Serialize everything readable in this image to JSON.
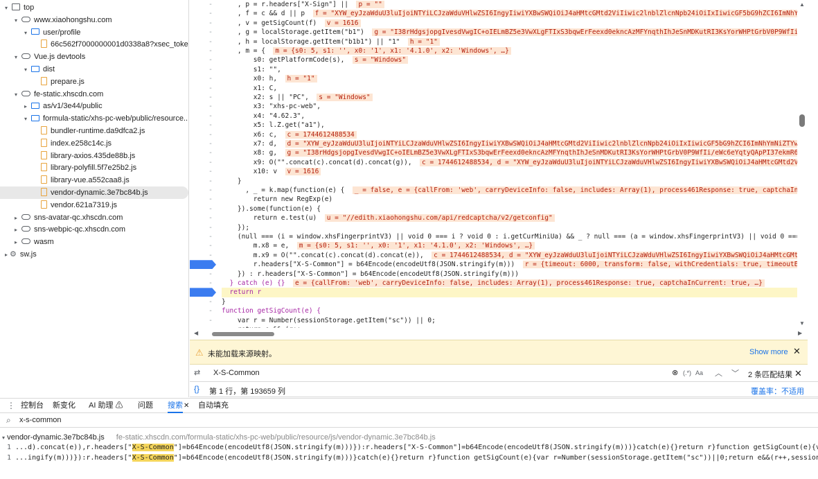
{
  "sources_tree": [
    {
      "label": "top",
      "icon": "frame-icon",
      "indent": 0,
      "arrow": "▾"
    },
    {
      "label": "www.xiaohongshu.com",
      "icon": "cloud-icon",
      "indent": 1,
      "arrow": "▾"
    },
    {
      "label": "user/profile",
      "icon": "folder-icon",
      "indent": 2,
      "arrow": "▾"
    },
    {
      "label": "66c562f7000000001d0338a8?xsec_token...",
      "icon": "file-icon",
      "indent": 3,
      "arrow": ""
    },
    {
      "label": "Vue.js devtools",
      "icon": "cloud-icon",
      "indent": 1,
      "arrow": "▾"
    },
    {
      "label": "dist",
      "icon": "folder-icon",
      "indent": 2,
      "arrow": "▾"
    },
    {
      "label": "prepare.js",
      "icon": "file-icon",
      "indent": 3,
      "arrow": ""
    },
    {
      "label": "fe-static.xhscdn.com",
      "icon": "cloud-icon",
      "indent": 1,
      "arrow": "▾"
    },
    {
      "label": "as/v1/3e44/public",
      "icon": "folder-icon",
      "indent": 2,
      "arrow": "▸"
    },
    {
      "label": "formula-static/xhs-pc-web/public/resource...",
      "icon": "folder-icon",
      "indent": 2,
      "arrow": "▾"
    },
    {
      "label": "bundler-runtime.da9dfca2.js",
      "icon": "file-icon",
      "indent": 3,
      "arrow": ""
    },
    {
      "label": "index.e258c14c.js",
      "icon": "file-icon",
      "indent": 3,
      "arrow": ""
    },
    {
      "label": "library-axios.435de88b.js",
      "icon": "file-icon",
      "indent": 3,
      "arrow": ""
    },
    {
      "label": "library-polyfill.5f7e25b2.js",
      "icon": "file-icon",
      "indent": 3,
      "arrow": ""
    },
    {
      "label": "library-vue.a552caa8.js",
      "icon": "file-icon",
      "indent": 3,
      "arrow": ""
    },
    {
      "label": "vendor-dynamic.3e7bc84b.js",
      "icon": "file-icon",
      "indent": 3,
      "arrow": "",
      "selected": true
    },
    {
      "label": "vendor.621a7319.js",
      "icon": "file-icon",
      "indent": 3,
      "arrow": ""
    },
    {
      "label": "sns-avatar-qc.xhscdn.com",
      "icon": "cloud-icon",
      "indent": 1,
      "arrow": "▸"
    },
    {
      "label": "sns-webpic-qc.xhscdn.com",
      "icon": "cloud-icon",
      "indent": 1,
      "arrow": "▸"
    },
    {
      "label": "wasm",
      "icon": "cloud-icon",
      "indent": 1,
      "arrow": "▸"
    },
    {
      "label": "sw.js",
      "icon": "gear-icon",
      "indent": 0,
      "arrow": "▸"
    }
  ],
  "code_lines": [
    {
      "text": "    , p = r.headers[\"X-Sign\"] ||",
      "ann": "p = \"\""
    },
    {
      "text": "    , f = c && d || p",
      "ann": "f = \"XYW_eyJzaWduU3luIjoiNTYiLCJzaWduVHlwZSI6IngyIiwiYXBwSWQiOiJ4aHMtcGMtd2ViIiwic2lnblZlcnNpb24iOiIxIiwicGF5bG9hZCI6ImNhYmNiZTYwZTA2ZjE"
    },
    {
      "text": "    , v = getSigCount(f)",
      "ann": "v = 1616"
    },
    {
      "text": "    , g = localStorage.getItem(\"b1\")",
      "ann": "g = \"I38rHdgsjopgIvesdVwgIC+oIELmBZ5e3VwXLgFTIxS3bqwErFeexd0ekncAzMFYnqthIhJeSnMDKutRI3KsYorWHPtGrbV0P9WfIi/eWc6eYqtyQAp"
    },
    {
      "text": "    , h = localStorage.getItem(\"b1b1\") || \"1\"",
      "ann": "h = \"1\""
    },
    {
      "text": "    , m = {",
      "ann": "m = {s0: 5, s1: '', x0: '1', x1: '4.1.0', x2: 'Windows', …}"
    },
    {
      "text": "        s0: getPlatformCode(s),",
      "ann": "s = \"Windows\""
    },
    {
      "text": "        s1: \"\",",
      "ann": ""
    },
    {
      "text": "        x0: h,",
      "ann": "h = \"1\""
    },
    {
      "text": "        x1: C,",
      "ann": ""
    },
    {
      "text": "        x2: s || \"PC\",",
      "ann": "s = \"Windows\""
    },
    {
      "text": "        x3: \"xhs-pc-web\",",
      "ann": ""
    },
    {
      "text": "        x4: \"4.62.3\",",
      "ann": ""
    },
    {
      "text": "        x5: l.Z.get(\"a1\"),",
      "ann": ""
    },
    {
      "text": "        x6: c,",
      "ann": "c = 1744612488534"
    },
    {
      "text": "        x7: d,",
      "ann": "d = \"XYW_eyJzaWduU3luIjoiNTYiLCJzaWduVHlwZSI6IngyIiwiYXBwSWQiOiJ4aHMtcGMtd2ViIiwic2lnblZlcnNpb24iOiIxIiwicGF5bG9hZCI6ImNhYmNiZTYwZTA2ZjE0OWU3ZWN"
    },
    {
      "text": "        x8: g,",
      "ann": "g = \"I38rHdgsjopgIvesdVwgIC+oIELmBZ5e3VwXLgFTIxS3bqwErFeexd0ekncAzMFYnqthIhJeSnMDKutRI3KsYorWHPtGrbV0P9WfIi/eWc6eYqtyQApPI37ekmR6QL+5Ii6sdneeSfq"
    },
    {
      "text": "        x9: O(\"\".concat(c).concat(d).concat(g)),",
      "ann": "c = 1744612488534, d = \"XYW_eyJzaWduU3luIjoiNTYiLCJzaWduVHlwZSI6IngyIiwiYXBwSWQiOiJ4aHMtcGMtd2ViIiwic2lnblZlcn"
    },
    {
      "text": "        x10: v",
      "ann": "v = 1616"
    },
    {
      "text": "    }",
      "ann": ""
    },
    {
      "text": "      , _ = k.map(function(e) {",
      "ann": "_ = false, e = {callFrom: 'web', carryDeviceInfo: false, includes: Array(1), process461Response: true, captchaInCurrent: true,"
    },
    {
      "text": "        return new RegExp(e)",
      "ann": ""
    },
    {
      "text": "    }).some(function(e) {",
      "ann": ""
    },
    {
      "text": "        return e.test(u)",
      "ann": "u = \"//edith.xiaohongshu.com/api/redcaptcha/v2/getconfig\""
    },
    {
      "text": "    });",
      "ann": ""
    },
    {
      "text": "    (null === (i = window.xhsFingerprintV3) || void 0 === i ? void 0 : i.getCurMiniUa) && _ ? null === (a = window.xhsFingerprintV3) || void 0 === a || a.getCurM",
      "ann": ""
    },
    {
      "text": "        m.x8 = e,",
      "ann": "m = {s0: 5, s1: '', x0: '1', x1: '4.1.0', x2: 'Windows', …}"
    },
    {
      "text": "        m.x9 = O(\"\".concat(c).concat(d).concat(e)),",
      "ann": "c = 1744612488534, d = \"XYW_eyJzaWduU3luIjoiNTYiLCJzaWduVHlwZSI6IngyIiwiYXBwSWQiOiJ4aHMtcGMtd2ViIiwic2lnblZlcn"
    },
    {
      "text": "        r.headers[\"X-S-Common\"] = b64Encode(encodeUtf8(JSON.stringify(m)))",
      "ann": "r = {timeout: 6000, transform: false, withCredentials: true, timeoutErrorMessa"
    },
    {
      "text": "    }) : r.headers[\"X-S-Common\"] = b64Encode(encodeUtf8(JSON.stringify(m)))",
      "ann": ""
    },
    {
      "text": "  } catch (e) {}",
      "ann": "e = {callFrom: 'web', carryDeviceInfo: false, includes: Array(1), process461Response: true, captchaInCurrent: true, …}"
    },
    {
      "text": "  return r",
      "ann": ""
    },
    {
      "text": "}",
      "ann": ""
    },
    {
      "text": "function getSigCount(e) {",
      "ann": ""
    },
    {
      "text": "    var r = Number(sessionStorage.getItem(\"sc\")) || 0;",
      "ann": ""
    },
    {
      "text": "    return e && (r++,",
      "ann": ""
    }
  ],
  "gutter": [
    "-",
    "-",
    "-",
    "-",
    "-",
    "-",
    "-",
    "-",
    "-",
    "-",
    "-",
    "-",
    "-",
    "-",
    "-",
    "-",
    "-",
    "-",
    "-",
    "-",
    "-",
    "-",
    "-",
    "-",
    "-",
    "-",
    "-",
    "-",
    "",
    "-",
    "-",
    "",
    "-",
    "-",
    "-"
  ],
  "warning": {
    "text": "未能加载来源映射。",
    "show_more": "Show more"
  },
  "find_bar": {
    "value": "X-S-Common",
    "regex": "(.*)",
    "case": "Aa",
    "match_count": "2 条匹配结果"
  },
  "status_bar": {
    "position": "第 1 行，第 193659 列",
    "coverage": "覆盖率：不适用"
  },
  "drawer_tabs": [
    "控制台",
    "新变化",
    "AI 助理 ⚠",
    "问题",
    "搜索",
    "自动填充"
  ],
  "drawer_search": {
    "value": "x-s-common"
  },
  "search_result": {
    "file": "vendor-dynamic.3e7bc84b.js",
    "url": "fe-static.xhscdn.com/formula-static/xhs-pc-web/public/resource/js/vendor-dynamic.3e7bc84b.js",
    "lines": [
      {
        "num": "1",
        "pre": "...d).concat(e)),r.headers[\"",
        "match": "X-S-Common",
        "post": "\"]=b64Encode(encodeUtf8(JSON.stringify(m)))}):r.headers[\"X-S-Common\"]=b64Encode(encodeUtf8(JSON.stringify(m)))}catch(e){}return r}function getSigCount(e){var r=Number(sessionStorage.getItem(\"sc\"))||0;retur"
      },
      {
        "num": "1",
        "pre": "...ingify(m)))}):r.headers[\"",
        "match": "X-S-Common",
        "post": "\"]=b64Encode(encodeUtf8(JSON.stringify(m)))}catch(e){}return r}function getSigCount(e){var r=Number(sessionStorage.getItem(\"sc\"))||0;return e&&(r++,sessionStorage.setItem(\"sc\",r.toString())),r}i(42876),i(33933);va"
      }
    ]
  },
  "colors": {
    "accent": "#1a73e8",
    "breakpoint": "#3b7cf0",
    "highlight": "#fdf6c6",
    "match": "#f5d65c"
  }
}
